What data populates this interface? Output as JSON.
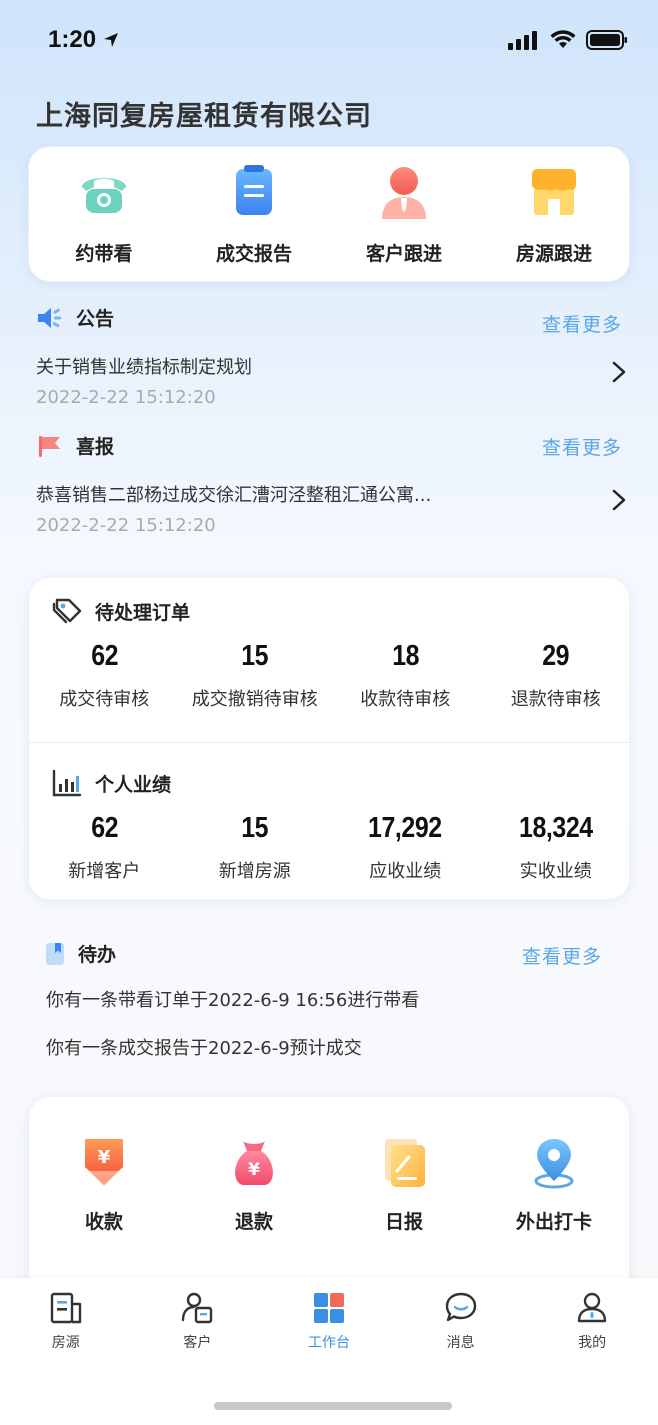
{
  "status": {
    "time": "1:20"
  },
  "company_name": "上海同复房屋租赁有限公司",
  "quick_actions": [
    {
      "label": "约带看",
      "icon": "phone-icon"
    },
    {
      "label": "成交报告",
      "icon": "report-icon"
    },
    {
      "label": "客户跟进",
      "icon": "customer-icon"
    },
    {
      "label": "房源跟进",
      "icon": "store-icon"
    }
  ],
  "announcement": {
    "title": "公告",
    "more": "查看更多",
    "text": "关于销售业绩指标制定规划",
    "date": "2022-2-22 15:12:20"
  },
  "good_news": {
    "title": "喜报",
    "more": "查看更多",
    "text": "恭喜销售二部杨过成交徐汇漕河泾整租汇通公寓...",
    "date": "2022-2-22 15:12:20"
  },
  "pending_orders": {
    "title": "待处理订单",
    "items": [
      {
        "value": "62",
        "label": "成交待审核"
      },
      {
        "value": "15",
        "label": "成交撤销待审核"
      },
      {
        "value": "18",
        "label": "收款待审核"
      },
      {
        "value": "29",
        "label": "退款待审核"
      }
    ]
  },
  "performance": {
    "title": "个人业绩",
    "items": [
      {
        "value": "62",
        "label": "新增客户"
      },
      {
        "value": "15",
        "label": "新增房源"
      },
      {
        "value": "17,292",
        "label": "应收业绩"
      },
      {
        "value": "18,324",
        "label": "实收业绩"
      }
    ]
  },
  "todo": {
    "title": "待办",
    "more": "查看更多",
    "items": [
      "你有一条带看订单于2022-6-9 16:56进行带看",
      "你有一条成交报告于2022-6-9预计成交"
    ]
  },
  "tools": [
    {
      "label": "收款",
      "icon": "collect-icon"
    },
    {
      "label": "退款",
      "icon": "refund-icon"
    },
    {
      "label": "日报",
      "icon": "daily-report-icon"
    },
    {
      "label": "外出打卡",
      "icon": "location-icon"
    }
  ],
  "tabs": [
    {
      "label": "房源",
      "active": false
    },
    {
      "label": "客户",
      "active": false
    },
    {
      "label": "工作台",
      "active": true
    },
    {
      "label": "消息",
      "active": false
    },
    {
      "label": "我的",
      "active": false
    }
  ],
  "colors": {
    "accent": "#3a8fe0",
    "link": "#5aa6e6"
  }
}
